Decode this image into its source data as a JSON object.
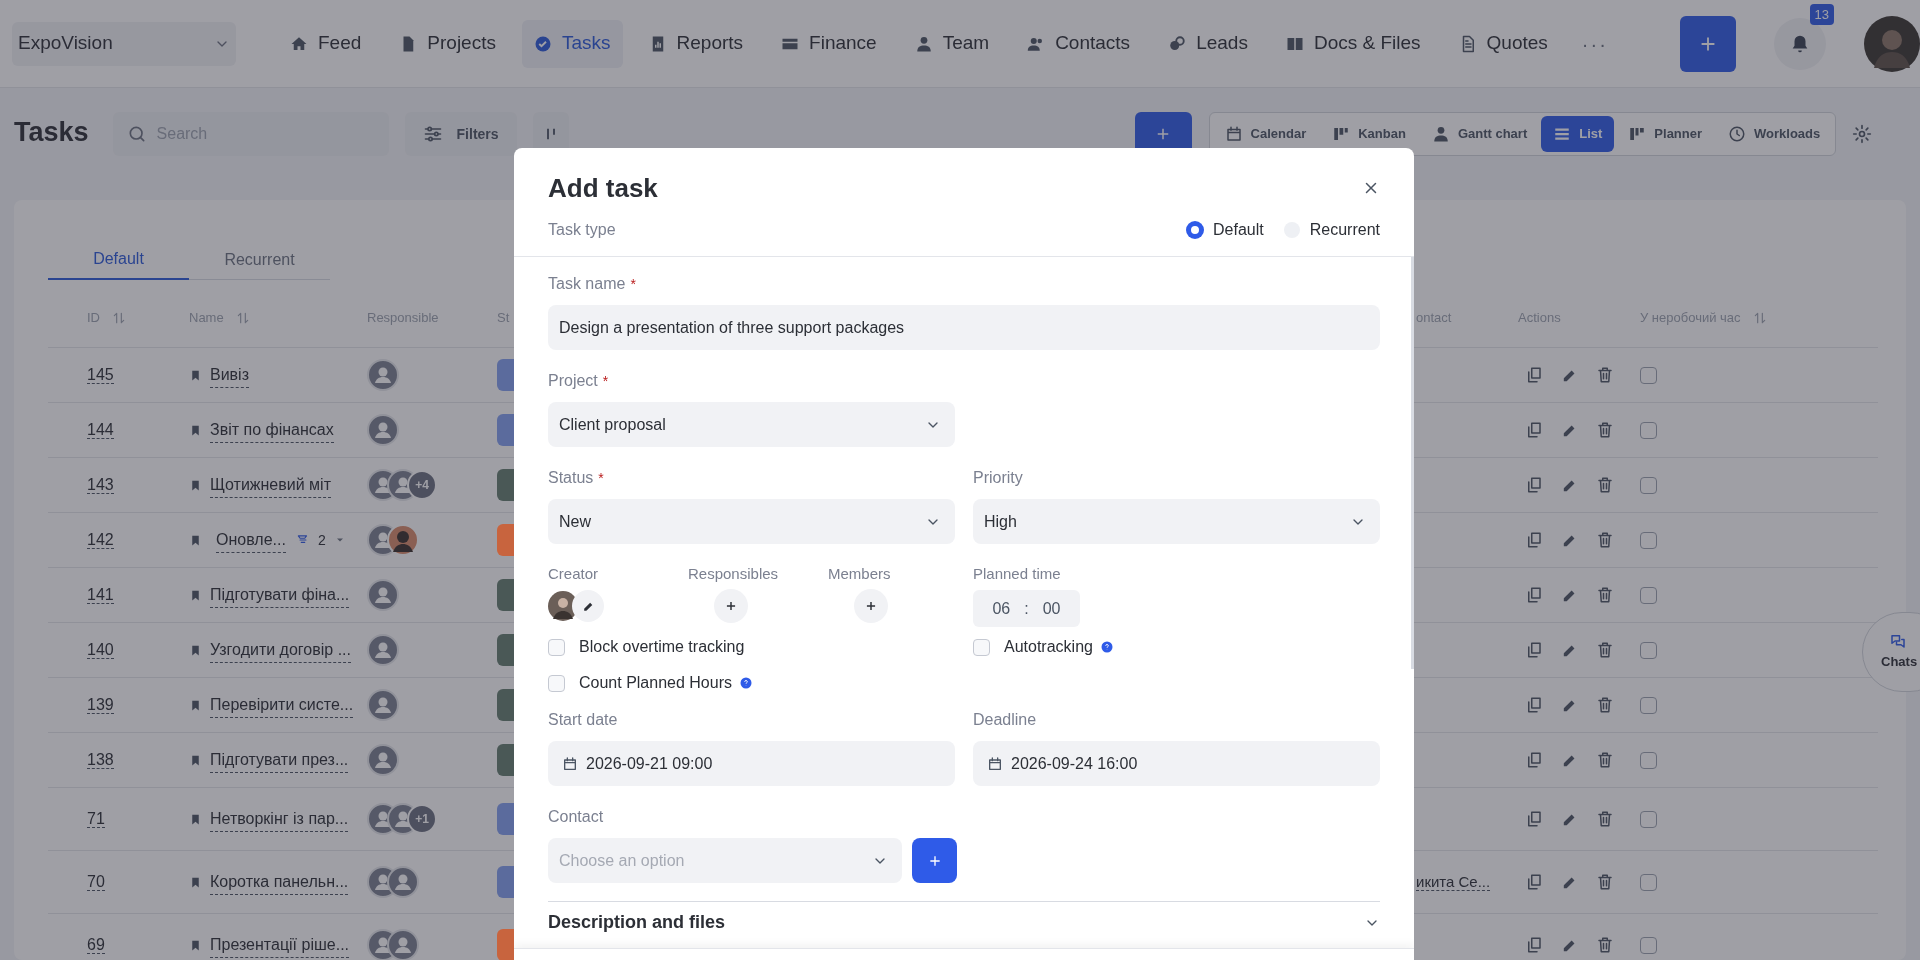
{
  "nav": {
    "org": "ExpoVision",
    "items": [
      {
        "label": "Feed",
        "selected": false
      },
      {
        "label": "Projects",
        "selected": false
      },
      {
        "label": "Tasks",
        "selected": true
      },
      {
        "label": "Reports",
        "selected": false
      },
      {
        "label": "Finance",
        "selected": false
      },
      {
        "label": "Team",
        "selected": false
      },
      {
        "label": "Contacts",
        "selected": false
      },
      {
        "label": "Leads",
        "selected": false
      },
      {
        "label": "Docs & Files",
        "selected": false
      },
      {
        "label": "Quotes",
        "selected": false
      }
    ],
    "more": "···",
    "notifications": "13"
  },
  "toolbar": {
    "title": "Tasks",
    "search_placeholder": "Search",
    "filters": "Filters",
    "views": [
      {
        "label": "Calendar",
        "selected": false
      },
      {
        "label": "Kanban",
        "selected": false
      },
      {
        "label": "Gantt chart",
        "selected": false
      },
      {
        "label": "List",
        "selected": true
      },
      {
        "label": "Planner",
        "selected": false
      },
      {
        "label": "Workloads",
        "selected": false
      }
    ]
  },
  "task_tabs": [
    {
      "label": "Default",
      "selected": true
    },
    {
      "label": "Recurrent",
      "selected": false
    }
  ],
  "table": {
    "columns": [
      "ID",
      "Name",
      "Responsible",
      "St",
      "ontact",
      "Actions",
      "У неробочий час"
    ],
    "sortable": [
      true,
      true,
      false,
      false,
      false,
      false,
      true
    ],
    "rows": [
      {
        "id": "145",
        "name": "Вивіз",
        "responsible": [
          {
            "kind": "person"
          }
        ],
        "color": "#5b6b9d",
        "checked": false
      },
      {
        "id": "144",
        "name": "Звіт по фінансах",
        "responsible": [
          {
            "kind": "person"
          }
        ],
        "color": "#5b6b9d",
        "checked": false
      },
      {
        "id": "143",
        "name": "Щотижневий міт",
        "responsible": [
          {
            "kind": "person"
          },
          {
            "kind": "person"
          },
          {
            "kind": "more",
            "text": "+4"
          }
        ],
        "color": "#4a5856",
        "checked": false
      },
      {
        "id": "142",
        "name": "Оновле...",
        "subtasks": "2",
        "responsible": [
          {
            "kind": "person"
          },
          {
            "kind": "photo"
          }
        ],
        "color": "#c8643e",
        "checked": false
      },
      {
        "id": "141",
        "name": "Підготувати фіна...",
        "responsible": [
          {
            "kind": "person"
          }
        ],
        "color": "#4a5856",
        "checked": false
      },
      {
        "id": "140",
        "name": "Узгодити договір ...",
        "responsible": [
          {
            "kind": "person"
          }
        ],
        "color": "#4a5856",
        "checked": false
      },
      {
        "id": "139",
        "name": "Перевірити систе...",
        "responsible": [
          {
            "kind": "person"
          }
        ],
        "color": "#4a5856",
        "checked": false
      },
      {
        "id": "138",
        "name": "Підготувати през...",
        "responsible": [
          {
            "kind": "person"
          }
        ],
        "color": "#4a5856",
        "checked": false
      },
      {
        "id": "71",
        "name": "Нетворкінг із пар...",
        "responsible": [
          {
            "kind": "person"
          },
          {
            "kind": "person"
          },
          {
            "kind": "more",
            "text": "+1"
          }
        ],
        "color": "#5b6b9d",
        "checked": false
      },
      {
        "id": "70",
        "name": "Коротка панельн...",
        "responsible": [
          {
            "kind": "person"
          },
          {
            "kind": "person"
          }
        ],
        "color": "#5b6b9d",
        "contact": "икита Се...",
        "checked": false
      },
      {
        "id": "69",
        "name": "Презентації ріше...",
        "responsible": [
          {
            "kind": "person"
          },
          {
            "kind": "person"
          }
        ],
        "color": "#c8643e",
        "checked": false
      }
    ]
  },
  "chats": "Chats",
  "modal": {
    "title": "Add task",
    "task_type": {
      "label": "Task type",
      "options": [
        {
          "label": "Default",
          "selected": true
        },
        {
          "label": "Recurrent",
          "selected": false
        }
      ]
    },
    "task_name": {
      "label": "Task name",
      "required": "*",
      "value": "Design a presentation of three support packages"
    },
    "project": {
      "label": "Project",
      "required": "*",
      "value": "Client proposal"
    },
    "status": {
      "label": "Status",
      "required": "*",
      "value": "New"
    },
    "priority": {
      "label": "Priority",
      "value": "High"
    },
    "people": [
      {
        "label": "Creator",
        "kind": "creator"
      },
      {
        "label": "Responsibles",
        "kind": "add"
      },
      {
        "label": "Members",
        "kind": "add"
      }
    ],
    "planned_time": {
      "label": "Planned time",
      "hours": "06",
      "separator": ":",
      "minutes": "00"
    },
    "checkboxes": [
      {
        "label": "Block overtime tracking",
        "checked": false,
        "help": false
      },
      {
        "label": "Autotracking",
        "checked": false,
        "help": true
      },
      {
        "label": "Count Planned Hours",
        "checked": false,
        "help": true
      }
    ],
    "start_date": {
      "label": "Start date",
      "value": "2026-09-21 09:00"
    },
    "deadline": {
      "label": "Deadline",
      "value": "2026-09-24 16:00"
    },
    "contact": {
      "label": "Contact",
      "placeholder": "Choose an option"
    },
    "description": {
      "label": "Description and files",
      "expanded": false
    }
  }
}
